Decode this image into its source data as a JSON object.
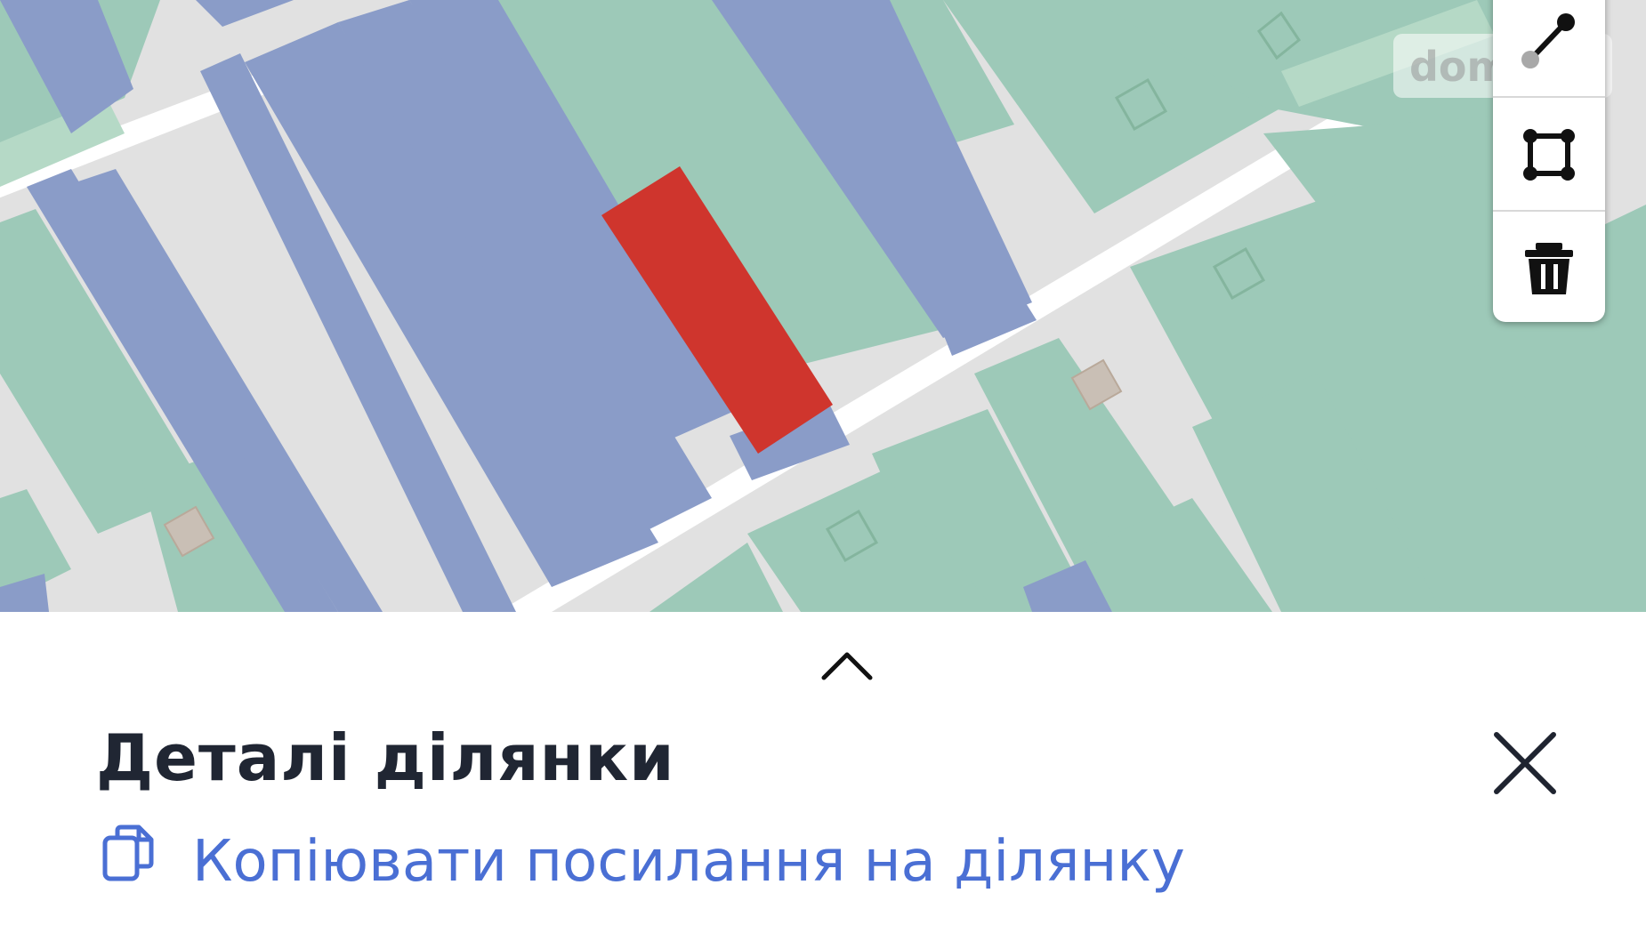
{
  "map": {
    "watermark_text": "dom",
    "colors": {
      "background": "#e1e1e1",
      "green_parcel": "#9dc9b8",
      "blue_parcel": "#8a9cc8",
      "selected_parcel": "#cf352d",
      "road": "#ffffff"
    },
    "toolbar": {
      "tools": [
        {
          "icon": "draw-line-icon"
        },
        {
          "icon": "draw-polygon-icon"
        },
        {
          "icon": "trash-icon"
        }
      ]
    }
  },
  "sheet": {
    "handle_icon": "chevron-up-icon",
    "title": "Деталі ділянки",
    "close_icon": "close-icon",
    "copy_icon": "copy-icon",
    "copy_link_label": "Копіювати посилання на ділянку",
    "link_color": "#4a6fd4"
  }
}
